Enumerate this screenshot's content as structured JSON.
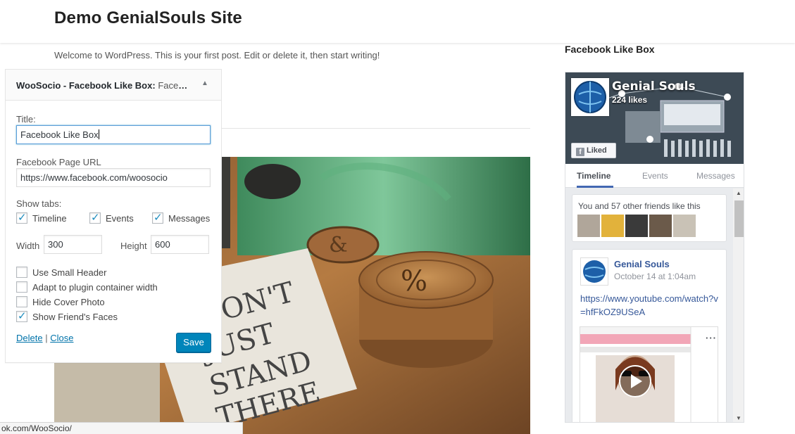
{
  "site": {
    "title": "Demo GenialSouls Site",
    "post_excerpt": "Welcome to WordPress. This is your first post. Edit or delete it, then start writing!"
  },
  "sidebar": {
    "widget_heading": "Facebook Like Box"
  },
  "fb_box": {
    "page_name": "Genial Souls",
    "likes": "224 likes",
    "liked_label": "Liked",
    "tabs": [
      "Timeline",
      "Events",
      "Messages"
    ],
    "active_tab": "Timeline",
    "friends_text": "You and 57 other friends like this",
    "post": {
      "author": "Genial Souls",
      "date": "October 14 at 1:04am",
      "link": "https://www.youtube.com/watch?v=hfFkOZ9USeA"
    },
    "colors": {
      "link": "#365899",
      "tab_underline": "#4267b2"
    }
  },
  "widget_panel": {
    "title_main": "WooSocio - Facebook Like Box:",
    "title_sub": "Facebo...",
    "toggle_icon": "arrow-up-icon",
    "title_label": "Title:",
    "title_value": "Facebook Like Box",
    "url_label": "Facebook Page URL",
    "url_value": "https://www.facebook.com/woosocio",
    "show_tabs_label": "Show tabs:",
    "tabs": [
      {
        "label": "Timeline",
        "checked": true
      },
      {
        "label": "Events",
        "checked": true
      },
      {
        "label": "Messages",
        "checked": true
      }
    ],
    "width_label": "Width",
    "width_value": "300",
    "height_label": "Height",
    "height_value": "600",
    "options": [
      {
        "label": "Use Small Header",
        "checked": false
      },
      {
        "label": "Adapt to plugin container width",
        "checked": false
      },
      {
        "label": "Hide Cover Photo",
        "checked": false
      },
      {
        "label": "Show Friend's Faces",
        "checked": true
      }
    ],
    "delete_label": "Delete",
    "separator": "|",
    "close_label": "Close",
    "save_label": "Save",
    "colors": {
      "save_button": "#0085ba",
      "link": "#0073aa",
      "checkmark": "#1e8cbe"
    }
  },
  "status_bar": {
    "url": "ok.com/WooSocio/"
  }
}
